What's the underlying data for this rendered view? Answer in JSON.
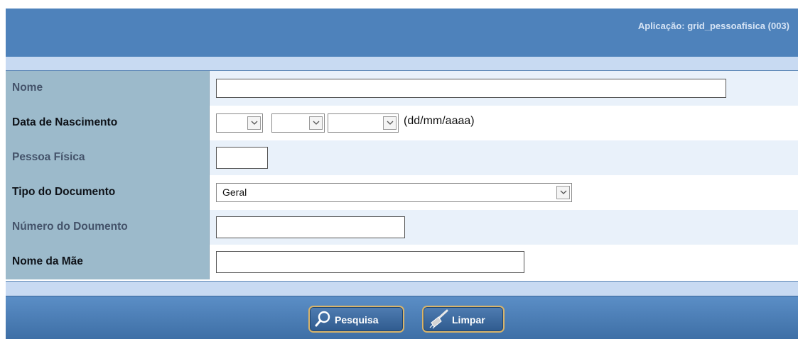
{
  "header": {
    "app_title": "Aplicação: grid_pessoafisica (003)"
  },
  "form": {
    "nome": {
      "label": "Nome",
      "value": ""
    },
    "data_nascimento": {
      "label": "Data de Nascimento",
      "day": "",
      "month": "",
      "year": "",
      "format_hint": "(dd/mm/aaaa)"
    },
    "pessoa_fisica": {
      "label": "Pessoa Física",
      "value": ""
    },
    "tipo_documento": {
      "label": "Tipo do Documento",
      "selected": "Geral"
    },
    "numero_documento": {
      "label": "Número do Doumento",
      "value": ""
    },
    "nome_mae": {
      "label": "Nome da Mãe",
      "value": ""
    }
  },
  "toolbar": {
    "search_label": "Pesquisa",
    "clear_label": "Limpar"
  }
}
